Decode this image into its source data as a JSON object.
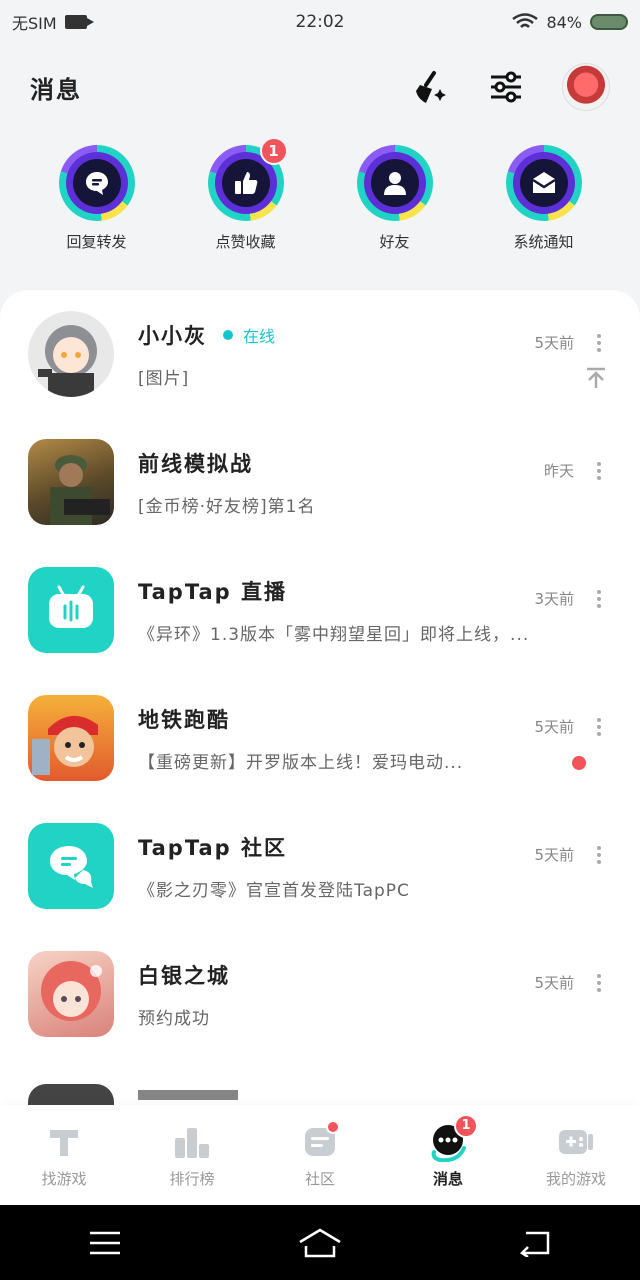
{
  "status_bar": {
    "carrier": "无SIM",
    "time": "22:02",
    "battery": "84%"
  },
  "header": {
    "title": "消息"
  },
  "quick": [
    {
      "label": "回复转发",
      "icon": "chat-bubble-icon",
      "badge": ""
    },
    {
      "label": "点赞收藏",
      "icon": "thumbs-up-icon",
      "badge": "1"
    },
    {
      "label": "好友",
      "icon": "person-icon",
      "badge": ""
    },
    {
      "label": "系统通知",
      "icon": "envelope-icon",
      "badge": ""
    }
  ],
  "messages": [
    {
      "name": "小小灰",
      "status": "在线",
      "preview": "[图片]",
      "time": "5天前"
    },
    {
      "name": "前线模拟战",
      "preview": "[金币榜·好友榜]第1名",
      "time": "昨天"
    },
    {
      "name": "TapTap 直播",
      "preview": "《异环》1.3版本「雾中翔望星回」即将上线，...",
      "time": "3天前"
    },
    {
      "name": "地铁跑酷",
      "preview": "【重磅更新】开罗版本上线！爱玛电动...",
      "time": "5天前"
    },
    {
      "name": "TapTap 社区",
      "preview": "《影之刃零》官宣首发登陆TapPC",
      "time": "5天前"
    },
    {
      "name": "白银之城",
      "preview": "预约成功",
      "time": "5天前"
    }
  ],
  "tabs": [
    {
      "label": "找游戏",
      "icon": "taptap-icon"
    },
    {
      "label": "排行榜",
      "icon": "ranking-icon"
    },
    {
      "label": "社区",
      "icon": "community-icon"
    },
    {
      "label": "消息",
      "icon": "message-icon",
      "badge": "1"
    },
    {
      "label": "我的游戏",
      "icon": "gamepad-icon"
    }
  ],
  "colors": {
    "accent": "#15c5ce",
    "badge": "#f2545b",
    "ring_inner": "#5d2fd6"
  }
}
